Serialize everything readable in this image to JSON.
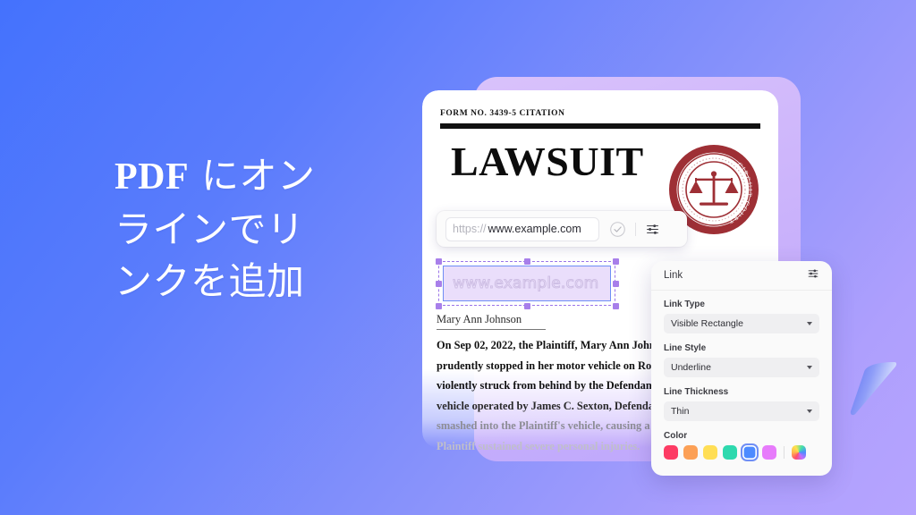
{
  "background": {
    "gradient_start": "#4472fd",
    "gradient_end": "#b6a4fe"
  },
  "headline": {
    "line1_latin": "PDF",
    "line1_jp": " にオン",
    "line2": "ラインでリ",
    "line3": "ンクを追加",
    "full_text": "PDF にオンラインでリンクを追加"
  },
  "document": {
    "form_no": "FORM NO. 3439-5 CITATION",
    "title": "LAWSUIT",
    "signature": "Mary Ann Johnson",
    "seal": {
      "top_text": "CIRCUIT COURT",
      "bottom_text": "THE WORLD AT LARGE",
      "color": "#9e2f35",
      "icon": "scales-of-justice-icon"
    },
    "body_lines": [
      "On Sep 02, 2022, the Plaintiff, Mary Ann Johnson,",
      "prudently stopped in her motor vehicle on Route",
      "violently struck from behind by the Defendant.",
      "vehicle operated by James C. Sexton, Defendant",
      "smashed into the Plaintiff's vehicle, causing a ca",
      "Plaintiff sustained severe personal injuries."
    ]
  },
  "url_toolbar": {
    "prefix": "https://",
    "value": "www.example.com",
    "placeholder": "www.example.com",
    "confirm_icon": "check-circle-icon",
    "settings_icon": "sliders-icon"
  },
  "link_selection": {
    "text": "www.example.com"
  },
  "panel": {
    "title": "Link",
    "settings_icon": "sliders-icon",
    "fields": [
      {
        "label": "Link Type",
        "value": "Visible Rectangle"
      },
      {
        "label": "Line Style",
        "value": "Underline"
      },
      {
        "label": "Line Thickness",
        "value": "Thin"
      }
    ],
    "color": {
      "label": "Color",
      "swatches": [
        "#fd3b64",
        "#fca056",
        "#ffde55",
        "#2ed9ae",
        "#4d8bff",
        "#e77bfb"
      ],
      "selected_index": 4,
      "custom_label": "gradient-picker"
    }
  },
  "decoration": {
    "cone_label": "3d-cone-shape"
  }
}
